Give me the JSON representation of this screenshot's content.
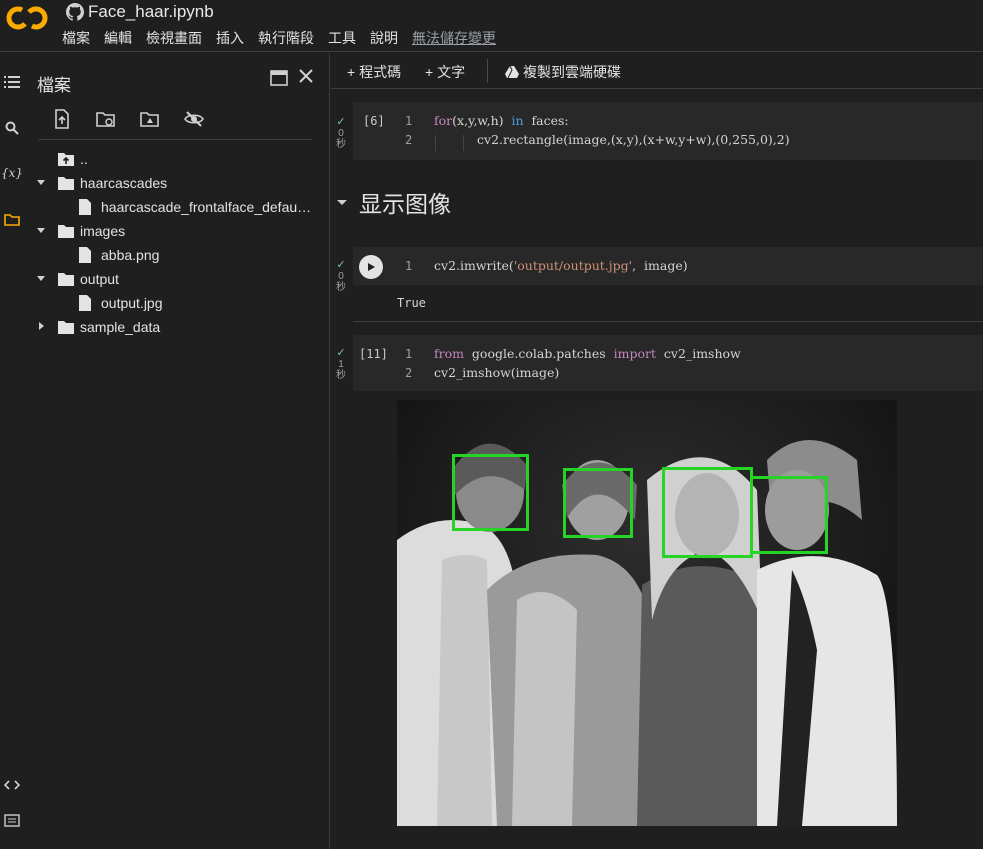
{
  "header": {
    "filename": "Face_haar.ipynb",
    "menu": [
      "檔案",
      "編輯",
      "檢視畫面",
      "插入",
      "執行階段",
      "工具",
      "說明"
    ],
    "unsaved_label": "無法儲存變更"
  },
  "panel": {
    "title": "檔案",
    "tree": {
      "parent": "..",
      "haarcascades": "haarcascades",
      "haar_file": "haarcascade_frontalface_defau…",
      "images": "images",
      "abba": "abba.png",
      "output": "output",
      "output_file": "output.jpg",
      "sample_data": "sample_data"
    }
  },
  "toolbar": {
    "add_code": "+ 程式碼",
    "add_text": "+ 文字",
    "copy_drive": "複製到雲端硬碟"
  },
  "cells": {
    "c1": {
      "exec": "[6]",
      "duration": "0",
      "unit": "秒",
      "ln1": "1",
      "ln2": "2",
      "line1_kw": "for",
      "line1_a": "(x,y,w,h)  ",
      "line1_in": "in",
      "line1_b": "  faces:",
      "line2": "cv2.rectangle(image,(x,y),(x+w,y+w),(0,255,0),2)"
    },
    "section": "显示图像",
    "c2": {
      "duration": "0",
      "unit": "秒",
      "ln1": "1",
      "line1_a": "cv2.imwrite(",
      "line1_str": "'output/output.jpg'",
      "line1_b": ",  image)",
      "output": "True"
    },
    "c3": {
      "exec": "[11]",
      "duration": "1",
      "unit": "秒",
      "ln1": "1",
      "ln2": "2",
      "line1_from": "from",
      "line1_mod": "  google.colab.patches  ",
      "line1_import": "import",
      "line1_fn": "  cv2_imshow",
      "line2": "cv2_imshow(image)"
    }
  },
  "colors": {
    "accent_orange": "#f9ab00",
    "box_green": "#25d425",
    "check_green": "#81c995"
  }
}
